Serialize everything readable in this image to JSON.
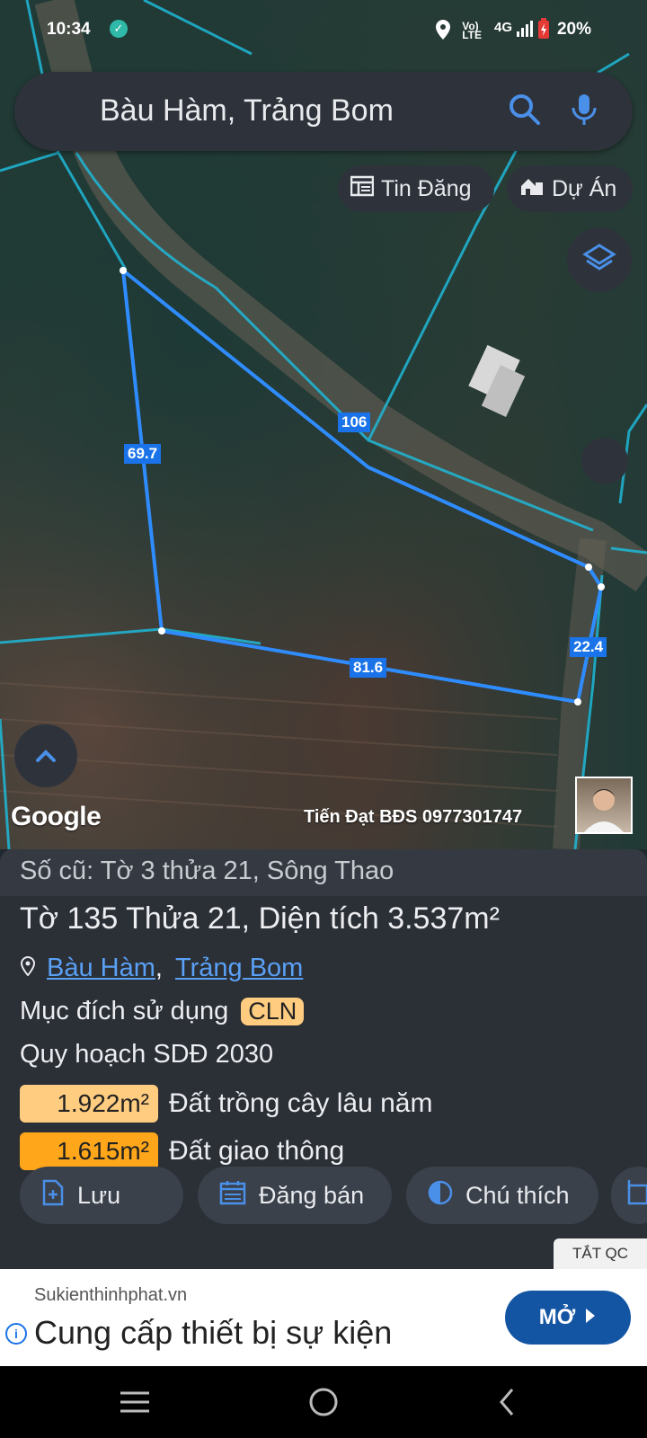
{
  "status_bar": {
    "time": "10:34",
    "network": "4G",
    "battery": "20%"
  },
  "search": {
    "query": "Bàu Hàm, Trảng Bom"
  },
  "chips": [
    {
      "label": "Tin Đăng",
      "icon": "listing-icon"
    },
    {
      "label": "Dự Án",
      "icon": "project-icon"
    }
  ],
  "map": {
    "edge_labels": [
      "106",
      "69.7",
      "81.6",
      "22.4"
    ],
    "attribution": "Google",
    "owner_text": "Tiến Đạt BĐS 0977301747"
  },
  "panel": {
    "old_ref": "Số cũ: Tờ 3 thửa 21, Sông Thao",
    "title": "Tờ 135 Thửa 21, Diện tích 3.537m²",
    "address_parts": [
      "Bàu Hàm",
      "Trảng Bom"
    ],
    "address_sep": ",",
    "purpose_label": "Mục đích sử dụng",
    "purpose_code": "CLN",
    "plan_label": "Quy hoạch SDĐ 2030",
    "zones": [
      {
        "area": "1.922m²",
        "name": "Đất trồng cây lâu năm",
        "color": "#ffcc80"
      },
      {
        "area": "1.615m²",
        "name": "Đất giao thông",
        "color": "#ffa61a"
      }
    ],
    "actions": [
      {
        "label": "Lưu",
        "icon": "save-add-icon"
      },
      {
        "label": "Đăng bán",
        "icon": "calendar-icon"
      },
      {
        "label": "Chú thích",
        "icon": "contrast-icon"
      }
    ]
  },
  "ad": {
    "close_label": "TẮT QC",
    "source": "Sukienthinhphat.vn",
    "title": "Cung cấp thiết bị sự kiện",
    "cta": "MỞ"
  },
  "colors": {
    "accent": "#1a73e8",
    "parcel_line": "#2f8cff",
    "background": "#2b2f36"
  }
}
